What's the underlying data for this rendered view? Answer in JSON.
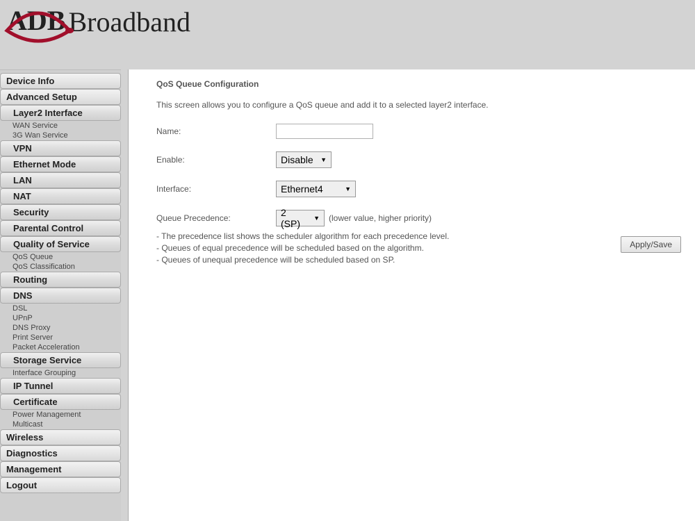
{
  "brand": {
    "letters": "ADB",
    "word": "Broadband"
  },
  "sidebar": {
    "device_info": "Device Info",
    "advanced_setup": "Advanced Setup",
    "layer2_interface": "Layer2 Interface",
    "wan_service": "WAN Service",
    "g3_wan_service": "3G Wan Service",
    "vpn": "VPN",
    "ethernet_mode": "Ethernet Mode",
    "lan": "LAN",
    "nat": "NAT",
    "security": "Security",
    "parental_control": "Parental Control",
    "qos": "Quality of Service",
    "qos_queue": "QoS Queue",
    "qos_classification": "QoS Classification",
    "routing": "Routing",
    "dns": "DNS",
    "dsl": "DSL",
    "upnp": "UPnP",
    "dns_proxy": "DNS Proxy",
    "print_server": "Print Server",
    "packet_acceleration": "Packet Acceleration",
    "storage_service": "Storage Service",
    "interface_grouping": "Interface Grouping",
    "ip_tunnel": "IP Tunnel",
    "certificate": "Certificate",
    "power_management": "Power Management",
    "multicast": "Multicast",
    "wireless": "Wireless",
    "diagnostics": "Diagnostics",
    "management": "Management",
    "logout": "Logout"
  },
  "main": {
    "title": "QoS Queue Configuration",
    "desc": "This screen allows you to configure a QoS queue and add it to a selected layer2 interface.",
    "labels": {
      "name": "Name:",
      "enable": "Enable:",
      "interface": "Interface:",
      "precedence": "Queue Precedence:"
    },
    "values": {
      "name": "",
      "enable": "Disable",
      "interface": "Ethernet4",
      "precedence": "2 (SP)"
    },
    "precedence_hint": "(lower value, higher priority)",
    "bullets": {
      "b1": "- The precedence list shows the scheduler algorithm for each precedence level.",
      "b2": "- Queues of equal precedence will be scheduled based on the algorithm.",
      "b3": "- Queues of unequal precedence will be scheduled based on SP."
    },
    "apply_label": "Apply/Save"
  }
}
